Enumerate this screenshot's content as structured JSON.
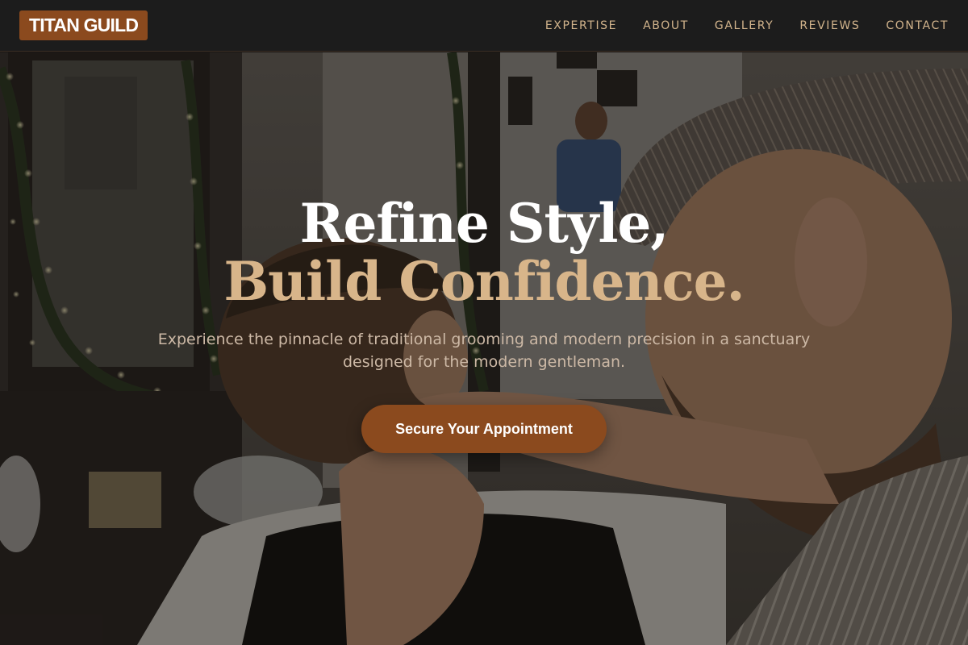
{
  "brand": {
    "logo_text": "TITAN GUILD",
    "accent": "#8b4a1e"
  },
  "nav": {
    "items": [
      {
        "label": "EXPERTISE"
      },
      {
        "label": "ABOUT"
      },
      {
        "label": "GALLERY"
      },
      {
        "label": "REVIEWS"
      },
      {
        "label": "CONTACT"
      }
    ],
    "link_color": "#d2b48c"
  },
  "hero": {
    "headline_line1": "Refine Style,",
    "headline_line2": "Build Confidence.",
    "highlight_color": "#d8b58a",
    "subtitle": "Experience the pinnacle of traditional grooming and modern precision in a sanctuary designed for the modern gentleman.",
    "cta_label": "Secure Your Appointment",
    "background_scene": "barber-cutting-hair-photo"
  }
}
